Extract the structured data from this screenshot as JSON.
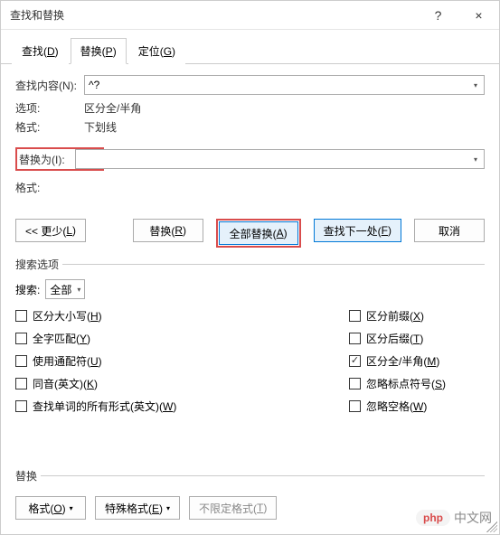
{
  "title": "查找和替换",
  "titlebar": {
    "help": "?",
    "close": "×"
  },
  "tabs": {
    "find": "查找(D)",
    "replace": "替换(P)",
    "goto": "定位(G)",
    "active": "replace"
  },
  "find": {
    "label": "查找内容(N):",
    "value": "^?",
    "options_label": "选项:",
    "options_value": "区分全/半角",
    "format_label": "格式:",
    "format_value": "下划线"
  },
  "replace": {
    "label": "替换为(I):",
    "value": "",
    "format_label": "格式:",
    "format_value": ""
  },
  "buttons": {
    "less": "<< 更少(L)",
    "replace": "替换(R)",
    "replace_all": "全部替换(A)",
    "find_next": "查找下一处(F)",
    "cancel": "取消",
    "format": "格式(O)",
    "special": "特殊格式(E)",
    "no_format": "不限定格式(T)"
  },
  "options": {
    "legend": "搜索选项",
    "search_label": "搜索:",
    "search_value": "全部",
    "checks_left": [
      {
        "label": "区分大小写(H)",
        "checked": false
      },
      {
        "label": "全字匹配(Y)",
        "checked": false
      },
      {
        "label": "使用通配符(U)",
        "checked": false
      },
      {
        "label": "同音(英文)(K)",
        "checked": false
      },
      {
        "label": "查找单词的所有形式(英文)(W)",
        "checked": false
      }
    ],
    "checks_right": [
      {
        "label": "区分前缀(X)",
        "checked": false
      },
      {
        "label": "区分后缀(T)",
        "checked": false
      },
      {
        "label": "区分全/半角(M)",
        "checked": true
      },
      {
        "label": "忽略标点符号(S)",
        "checked": false
      },
      {
        "label": "忽略空格(W)",
        "checked": false
      }
    ]
  },
  "bottom": {
    "legend": "替换"
  },
  "watermark": {
    "badge": "php",
    "text": "中文网"
  }
}
